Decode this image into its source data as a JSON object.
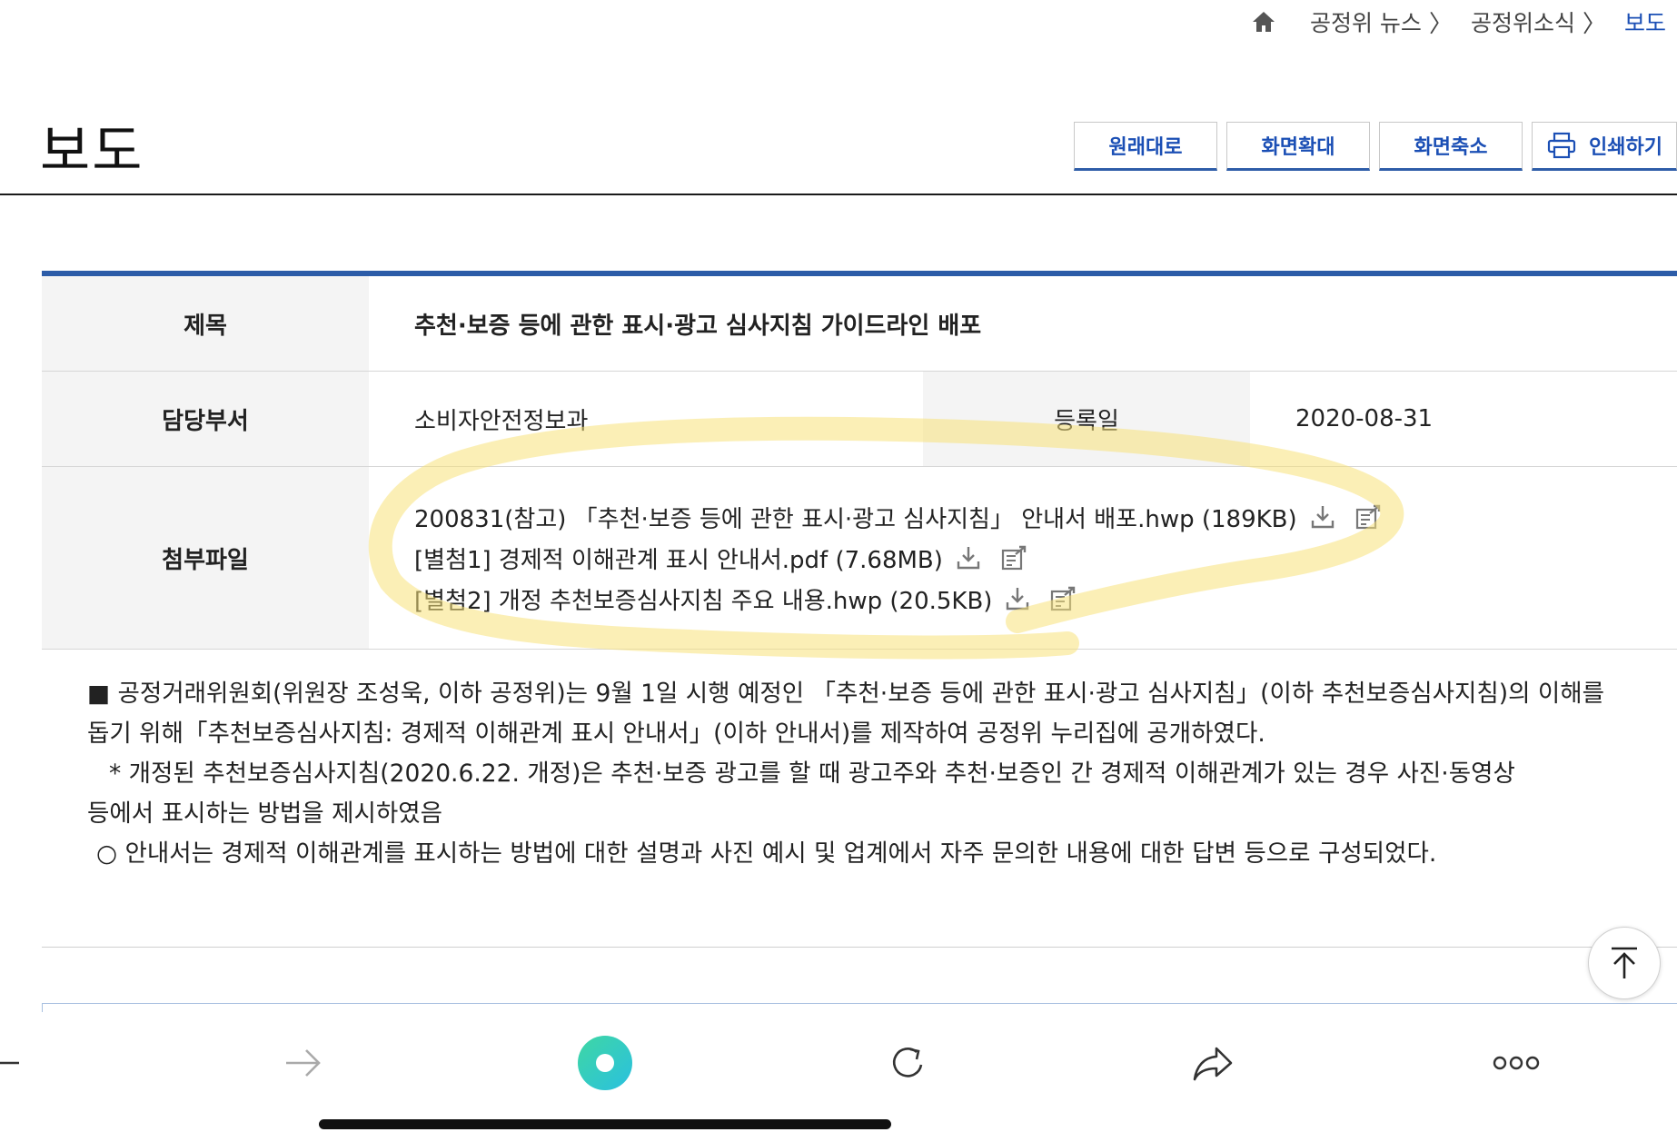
{
  "breadcrumb": {
    "items": [
      "공정위 뉴스",
      "공정위소식",
      "보도"
    ]
  },
  "page": {
    "title": "보도"
  },
  "toolbar": {
    "original_label": "원래대로",
    "zoom_in_label": "화면확대",
    "zoom_out_label": "화면축소",
    "print_label": "인쇄하기"
  },
  "info": {
    "title_header": "제목",
    "title_value": "추천·보증 등에 관한 표시·광고 심사지침 가이드라인 배포",
    "dept_header": "담당부서",
    "dept_value": "소비자안전정보과",
    "date_header": "등록일",
    "date_value": "2020-08-31",
    "files_header": "첨부파일",
    "files": [
      "200831(참고) 「추천·보증 등에 관한 표시·광고 심사지침」 안내서 배포.hwp (189KB)",
      "[별첨1] 경제적 이해관계 표시 안내서.pdf (7.68MB)",
      "[별첨2] 개정 추천보증심사지침 주요 내용.hwp (20.5KB)"
    ]
  },
  "content": {
    "para1": "■ 공정거래위원회(위원장 조성욱, 이하 공정위)는 9월 1일 시행 예정인 「추천·보증 등에 관한 표시·광고 심사지침」(이하 추천보증심사지침)의 이해를",
    "para1b": "돕기 위해「추천보증심사지침: 경제적 이해관계 표시 안내서」(이하 안내서)를 제작하여 공정위 누리집에 공개하였다.",
    "para2": "* 개정된 추천보증심사지침(2020.6.22. 개정)은 추천·보증 광고를 할 때 광고주와 추천·보증인 간 경제적 이해관계가 있는 경우 사진·동영상",
    "para2b": "등에서 표시하는 방법을 제시하였음",
    "para3": "○ 안내서는 경제적 이해관계를 표시하는 방법에 대한 설명과 사진 예시 및 업계에서 자주 문의한 내용에 대한 답변 등으로 구성되었다."
  },
  "colors": {
    "accent": "#2c5ca8",
    "link": "#1b4fb5",
    "highlighter": "#f7e27a"
  },
  "icons": [
    "home-icon",
    "chevron-right-icon",
    "printer-icon",
    "download-icon",
    "preview-icon",
    "arrow-up-icon",
    "back-icon",
    "forward-icon",
    "assistant-icon",
    "reload-icon",
    "share-icon",
    "more-icon"
  ]
}
